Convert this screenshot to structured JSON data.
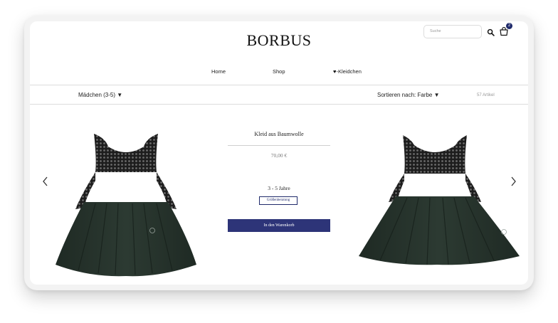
{
  "header": {
    "logo": "BORBUS",
    "search_placeholder": "Suche",
    "cart_count": "2"
  },
  "nav": {
    "items": [
      "Home",
      "Shop"
    ],
    "favorites_label": "-Kleidchen"
  },
  "filter_bar": {
    "category": "Mädchen (3-5) ▼",
    "sort": "Sortieren nach: Farbe ▼",
    "count": "57 Artikel"
  },
  "product": {
    "title": "Kleid aus Baumwolle",
    "price": "70,00 €",
    "size": "3 - 5 Jahre",
    "size_guide_label": "Größenberatung",
    "add_to_cart_label": "In den Warenkorb"
  },
  "colors": {
    "accent": "#2d3478",
    "dress": "#26322b",
    "sequins": "#1c1c1c"
  },
  "icons": {
    "search": "search-icon",
    "cart": "basket-icon",
    "prev": "chevron-left-icon",
    "next": "chevron-right-icon",
    "favorite": "heart-icon"
  }
}
